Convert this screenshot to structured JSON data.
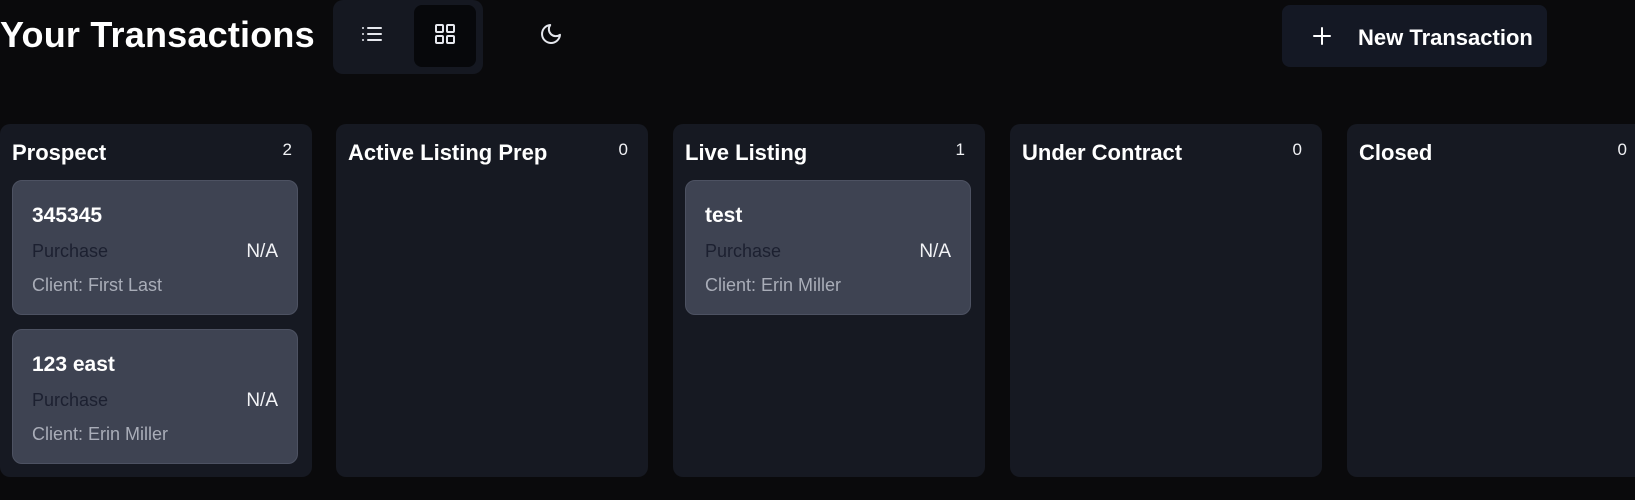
{
  "header": {
    "title": "Your Transactions",
    "view_toggle": {
      "list_icon": "list-icon",
      "grid_icon": "grid-icon",
      "active": "grid"
    },
    "theme_icon": "moon-icon",
    "new_button": {
      "icon": "plus-icon",
      "label": "New Transaction"
    }
  },
  "columns": [
    {
      "title": "Prospect",
      "count": "2",
      "cards": [
        {
          "title": "345345",
          "type": "Purchase",
          "price": "N/A",
          "client": "Client: First Last"
        },
        {
          "title": "123 east",
          "type": "Purchase",
          "price": "N/A",
          "client": "Client: Erin Miller"
        }
      ]
    },
    {
      "title": "Active Listing Prep",
      "count": "0",
      "cards": []
    },
    {
      "title": "Live Listing",
      "count": "1",
      "cards": [
        {
          "title": "test",
          "type": "Purchase",
          "price": "N/A",
          "client": "Client: Erin Miller"
        }
      ]
    },
    {
      "title": "Under Contract",
      "count": "0",
      "cards": []
    },
    {
      "title": "Closed",
      "count": "0",
      "cards": []
    }
  ],
  "colors": {
    "background": "#0a0a0c",
    "column": "#161922",
    "card": "#3e4352",
    "button": "#141824"
  }
}
